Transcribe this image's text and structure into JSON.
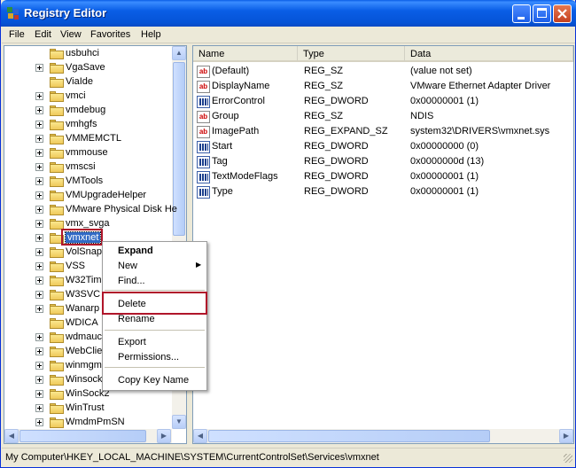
{
  "window": {
    "title": "Registry Editor"
  },
  "menu": [
    "File",
    "Edit",
    "View",
    "Favorites",
    "Help"
  ],
  "tree": {
    "items": [
      {
        "label": "usbuhci",
        "expander": false
      },
      {
        "label": "VgaSave",
        "expander": true
      },
      {
        "label": "ViaIde",
        "expander": false
      },
      {
        "label": "vmci",
        "expander": true
      },
      {
        "label": "vmdebug",
        "expander": true
      },
      {
        "label": "vmhgfs",
        "expander": true
      },
      {
        "label": "VMMEMCTL",
        "expander": true
      },
      {
        "label": "vmmouse",
        "expander": true
      },
      {
        "label": "vmscsi",
        "expander": true
      },
      {
        "label": "VMTools",
        "expander": true
      },
      {
        "label": "VMUpgradeHelper",
        "expander": true
      },
      {
        "label": "VMware Physical Disk He",
        "expander": true
      },
      {
        "label": "vmx_svga",
        "expander": true
      },
      {
        "label": "vmxnet",
        "expander": true,
        "selected": true
      },
      {
        "label": "VolSnap",
        "expander": true
      },
      {
        "label": "VSS",
        "expander": true
      },
      {
        "label": "W32Tim",
        "expander": true
      },
      {
        "label": "W3SVC",
        "expander": true
      },
      {
        "label": "Wanarp",
        "expander": true
      },
      {
        "label": "WDICA",
        "expander": false
      },
      {
        "label": "wdmauc",
        "expander": true
      },
      {
        "label": "WebClie",
        "expander": true
      },
      {
        "label": "winmgm",
        "expander": true
      },
      {
        "label": "Winsock",
        "expander": true
      },
      {
        "label": "WinSock2",
        "expander": true
      },
      {
        "label": "WinTrust",
        "expander": true
      },
      {
        "label": "WmdmPmSN",
        "expander": true
      }
    ]
  },
  "list": {
    "headers": [
      "Name",
      "Type",
      "Data"
    ],
    "rows": [
      {
        "icon": "string-value-icon",
        "name": "(Default)",
        "type": "REG_SZ",
        "data": "(value not set)"
      },
      {
        "icon": "string-value-icon",
        "name": "DisplayName",
        "type": "REG_SZ",
        "data": "VMware Ethernet Adapter Driver"
      },
      {
        "icon": "binary-value-icon",
        "name": "ErrorControl",
        "type": "REG_DWORD",
        "data": "0x00000001 (1)"
      },
      {
        "icon": "string-value-icon",
        "name": "Group",
        "type": "REG_SZ",
        "data": "NDIS"
      },
      {
        "icon": "string-value-icon",
        "name": "ImagePath",
        "type": "REG_EXPAND_SZ",
        "data": "system32\\DRIVERS\\vmxnet.sys"
      },
      {
        "icon": "binary-value-icon",
        "name": "Start",
        "type": "REG_DWORD",
        "data": "0x00000000 (0)"
      },
      {
        "icon": "binary-value-icon",
        "name": "Tag",
        "type": "REG_DWORD",
        "data": "0x0000000d (13)"
      },
      {
        "icon": "binary-value-icon",
        "name": "TextModeFlags",
        "type": "REG_DWORD",
        "data": "0x00000001 (1)"
      },
      {
        "icon": "binary-value-icon",
        "name": "Type",
        "type": "REG_DWORD",
        "data": "0x00000001 (1)"
      }
    ]
  },
  "context_menu": {
    "expand": "Expand",
    "new": "New",
    "find": "Find...",
    "delete": "Delete",
    "rename": "Rename",
    "export": "Export",
    "permissions": "Permissions...",
    "copy_key_name": "Copy Key Name"
  },
  "status": {
    "path": "My Computer\\HKEY_LOCAL_MACHINE\\SYSTEM\\CurrentControlSet\\Services\\vmxnet"
  },
  "colors": {
    "highlight": "#b0152a",
    "selection": "#316ac5",
    "titlebar": "#0a5ee6"
  }
}
